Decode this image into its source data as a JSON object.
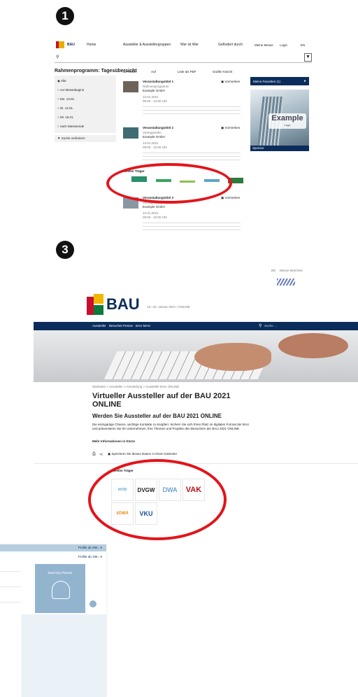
{
  "step1": {
    "number": "1",
    "nav": {
      "logo": "BAU",
      "items": [
        "Home",
        "Aussteller & Ausstellergruppen",
        "Wer ist Wer",
        "Gefördert durch"
      ],
      "right": [
        "Meine Messe",
        "Login",
        "EN"
      ]
    },
    "title": "Rahmenprogramm: Tagesübersicht",
    "filters": [
      "Alle",
      "vor Messebeginn",
      "Mo. 13.01.",
      "Di. 14.01.",
      "Mi. 15.01.",
      "nach Messeende"
    ],
    "reset_label": "Suche verfeinern",
    "toolbar": [
      "20 Treffer",
      "Auf",
      "Liste als PDF",
      "Grafik-Ansicht"
    ],
    "events": [
      {
        "title": "Veranstaltungstitel 1",
        "sub": "Rahmenprogramm",
        "org": "Example GmbH",
        "date": "13.01.2021",
        "time": "09:00 - 10:00 Uhr"
      },
      {
        "title": "Veranstaltungstitel 2",
        "sub": "Vortragsreihe",
        "org": "Example GmbH",
        "date": "13.01.2021",
        "time": "09:00 - 10:00 Uhr"
      },
      {
        "title": "Veranstaltungstitel 3",
        "sub": "Vortragsreihe",
        "org": "Example GmbH",
        "date": "13.01.2021",
        "time": "09:00 - 10:00 Uhr"
      }
    ],
    "add_label": "Vormerken",
    "partners_label": "Ideeller Träger",
    "favorites_label": "Meine Favoriten (1)",
    "example_logo": "Example",
    "example_sub": "Logo",
    "sponsor_label": "Sponsor"
  },
  "step3": {
    "number": "3",
    "lang": "DE",
    "top_link": "Messe München",
    "logo": "BAU",
    "tagline": "13.–15. Januar 2021 | ONLINE",
    "nav": [
      "Aussteller",
      "Besucher",
      "Presse",
      "BAU-MAG"
    ],
    "search_placeholder": "Suche ...",
    "breadcrumb": "Startseite > Aussteller > Anmeldung > Aussteller BAU ONLINE",
    "title": "Virtueller Aussteller auf der BAU 2021 ONLINE",
    "subtitle": "Werden Sie Aussteller auf der BAU 2021 ONLINE",
    "body": "Die einzigartige Chance, wichtige Kontakte zu knüpfen: Sichern Sie sich Ihren Platz im digitalen Format der BAU und präsentieren Sie Ihr Unternehmen, Ihre Themen und Projekte den Besuchern der BAU 2021 ONLINE.",
    "more": "Mehr Informationen in Kürze",
    "save_date": "Speichern Sie dieses Datum in Ihrem Kalender",
    "partners_label": "Ideeller Träger",
    "partners": [
      "IWSB",
      "DVGW",
      "DWA",
      "VAK",
      "VDMA",
      "VKU"
    ]
  },
  "step2_partial": {
    "profile1": "Profile ab 295,- €",
    "profile2": "Profile ab 195,- €",
    "matching": "Matching Planner"
  }
}
